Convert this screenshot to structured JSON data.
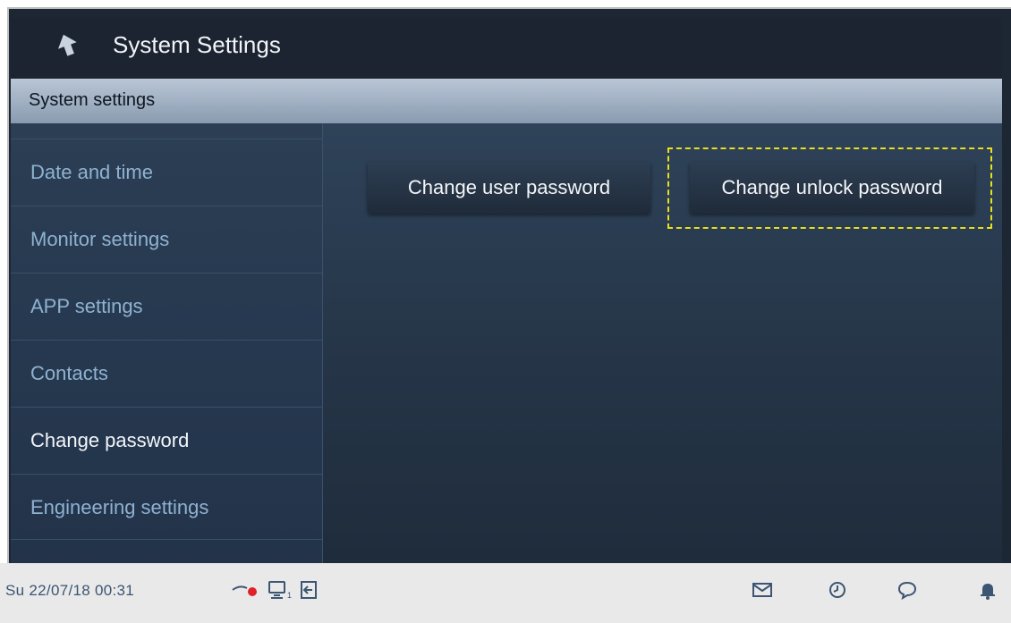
{
  "header": {
    "title": "System Settings"
  },
  "section": {
    "title": "System settings"
  },
  "sidebar": {
    "items": [
      {
        "label": "Date and time",
        "active": false
      },
      {
        "label": "Monitor settings",
        "active": false
      },
      {
        "label": "APP settings",
        "active": false
      },
      {
        "label": "Contacts",
        "active": false
      },
      {
        "label": "Change password",
        "active": true
      },
      {
        "label": "Engineering settings",
        "active": false
      }
    ]
  },
  "main": {
    "buttons": [
      {
        "label": "Change user password"
      },
      {
        "label": "Change unlock password",
        "highlighted": true
      }
    ]
  },
  "status": {
    "datetime": "Su 22/07/18  00:31",
    "monitor_count": "1",
    "icons": [
      "record-icon",
      "monitor-icon",
      "exit-icon",
      "mail-icon",
      "history-icon",
      "chat-icon",
      "bell-icon"
    ],
    "colors": {
      "record_dot": "#e0202a",
      "highlight": "#e8e01a"
    }
  }
}
